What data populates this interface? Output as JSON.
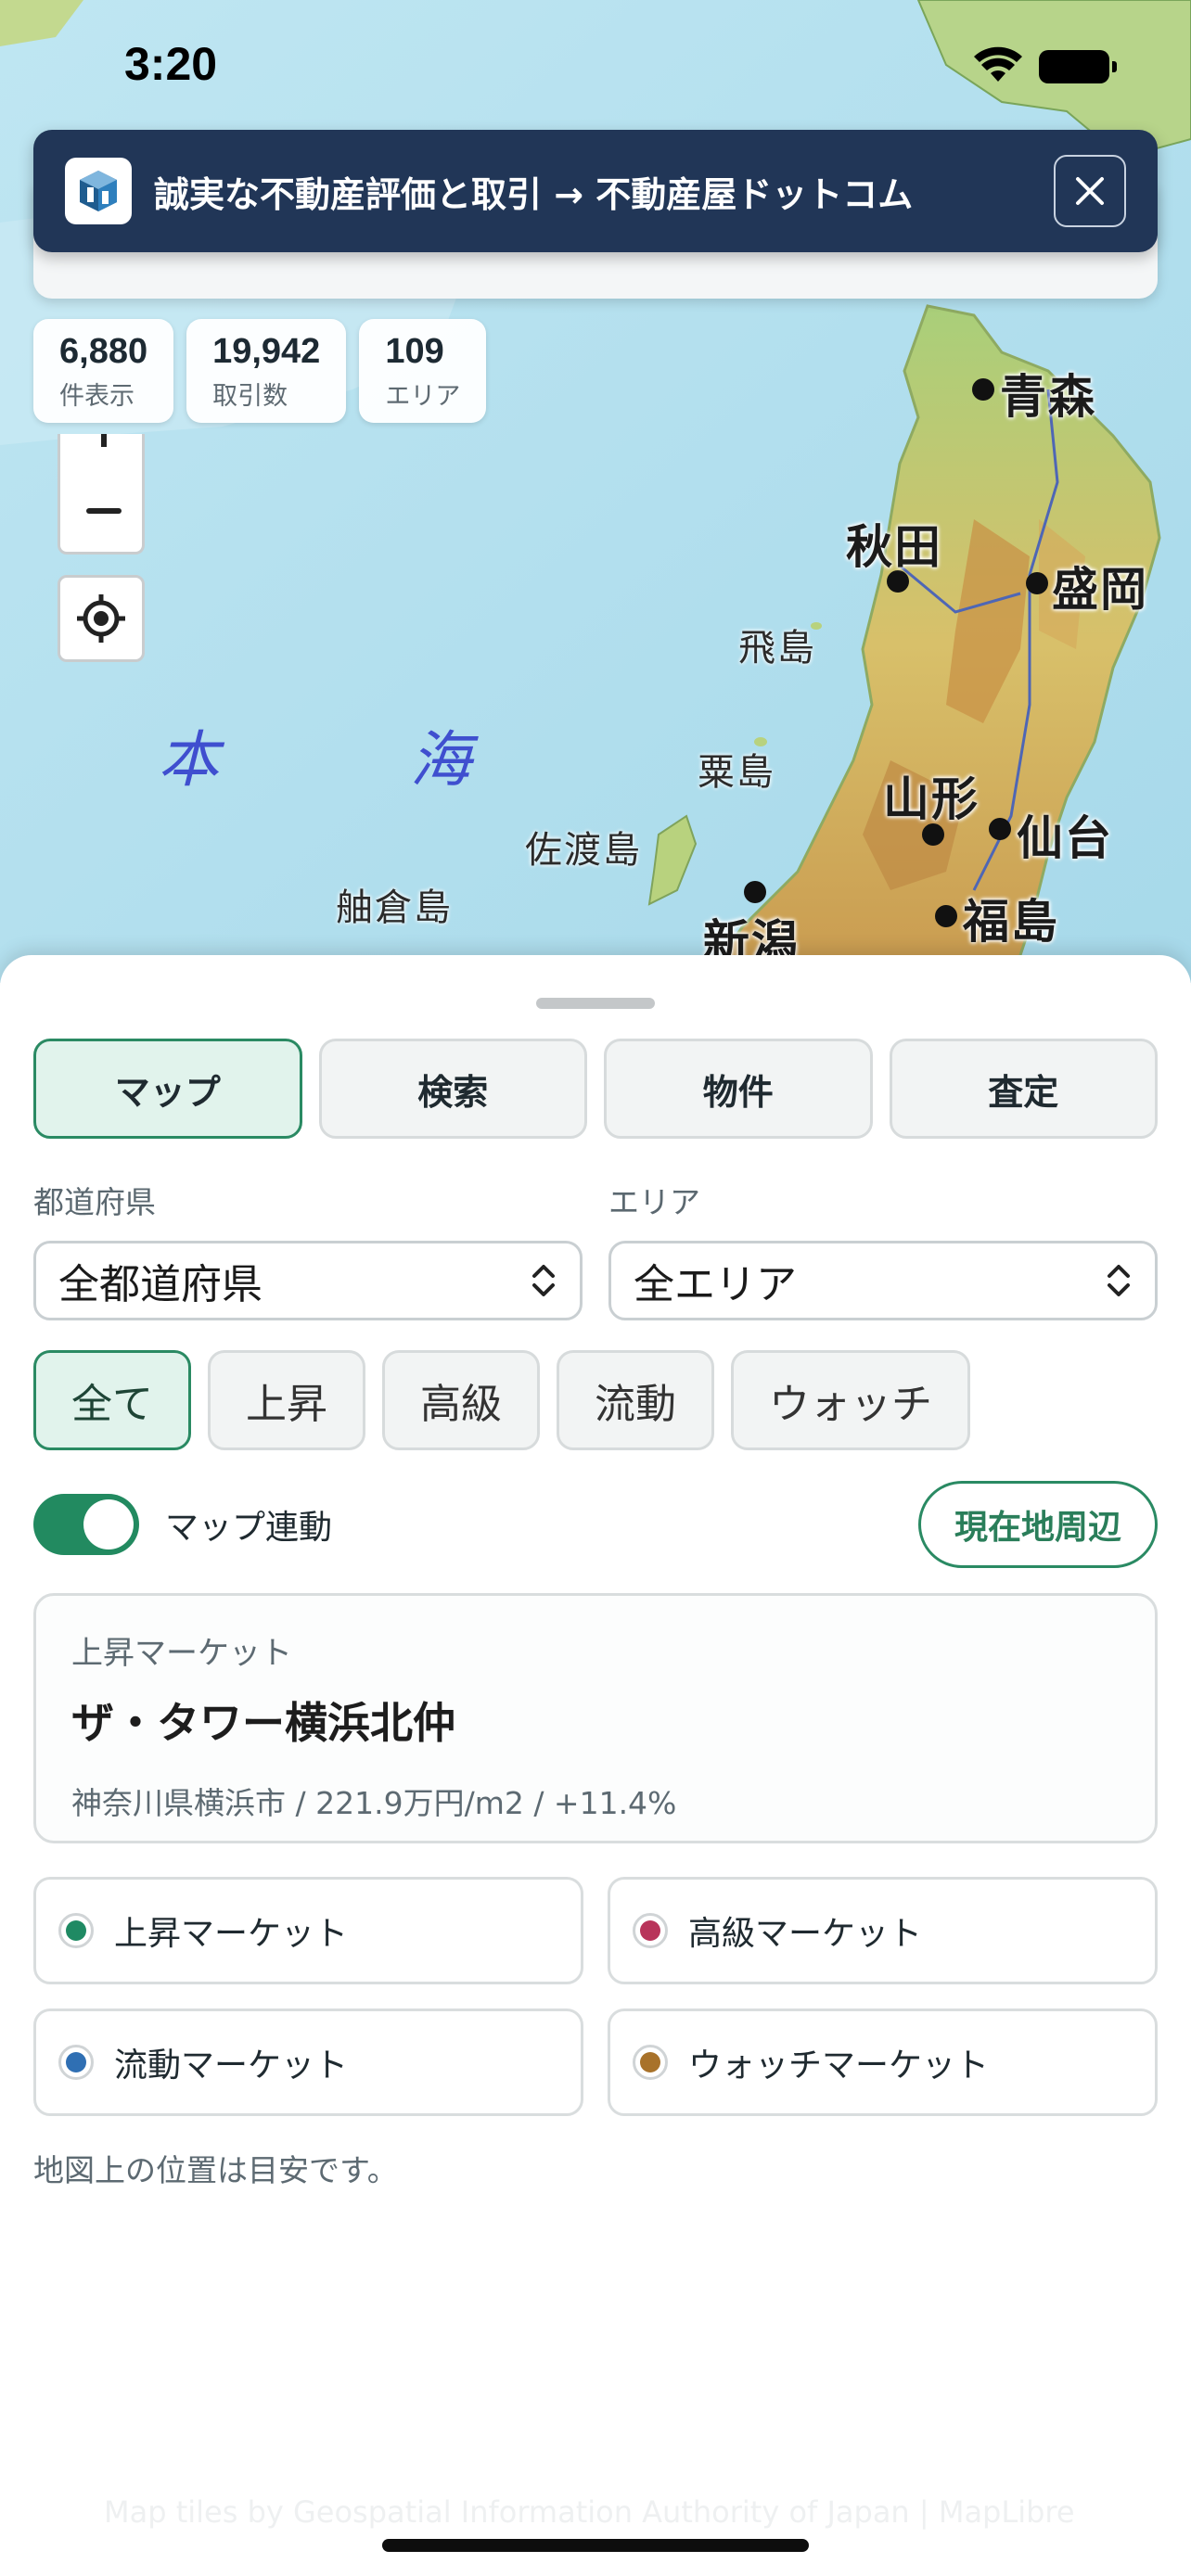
{
  "status_bar": {
    "time": "3:20"
  },
  "banner": {
    "text": "誠実な不動産評価と取引 → 不動産屋ドットコム"
  },
  "stats": [
    {
      "value": "6,880",
      "label": "件表示"
    },
    {
      "value": "19,942",
      "label": "取引数"
    },
    {
      "value": "109",
      "label": "エリア"
    }
  ],
  "map": {
    "places": {
      "aomori": "青森",
      "akita": "秋田",
      "morioka": "盛岡",
      "yamagata": "山形",
      "sendai": "仙台",
      "fukushima": "福島",
      "niigata": "新潟"
    },
    "islands": {
      "tobishima": "飛島",
      "awashima": "粟島",
      "sado": "佐渡島",
      "hegura": "舳倉島"
    },
    "sea": {
      "part1": "本",
      "part2": "海"
    },
    "attribution": "Map tiles by Geospatial Information Authority of Japan | MapLibre"
  },
  "tabs": [
    {
      "label": "マップ",
      "active": true
    },
    {
      "label": "検索",
      "active": false
    },
    {
      "label": "物件",
      "active": false
    },
    {
      "label": "査定",
      "active": false
    }
  ],
  "prefecture": {
    "label": "都道府県",
    "value": "全都道府県"
  },
  "area": {
    "label": "エリア",
    "value": "全エリア"
  },
  "filters": [
    {
      "label": "全て",
      "active": true
    },
    {
      "label": "上昇",
      "active": false
    },
    {
      "label": "高級",
      "active": false
    },
    {
      "label": "流動",
      "active": false
    },
    {
      "label": "ウォッチ",
      "active": false
    }
  ],
  "map_sync": {
    "label": "マップ連動",
    "on": true
  },
  "nearby_button": "現在地周辺",
  "featured": {
    "category": "上昇マーケット",
    "title": "ザ・タワー横浜北仲",
    "meta": "神奈川県横浜市 / 221.9万円/m2 / +11.4%"
  },
  "legend": [
    {
      "label": "上昇マーケット",
      "color": "#1f8a63"
    },
    {
      "label": "高級マーケット",
      "color": "#b8345a"
    },
    {
      "label": "流動マーケット",
      "color": "#2f6fb3"
    },
    {
      "label": "ウォッチマーケット",
      "color": "#a8722a"
    }
  ],
  "disclaimer": "地図上の位置は目安です。"
}
